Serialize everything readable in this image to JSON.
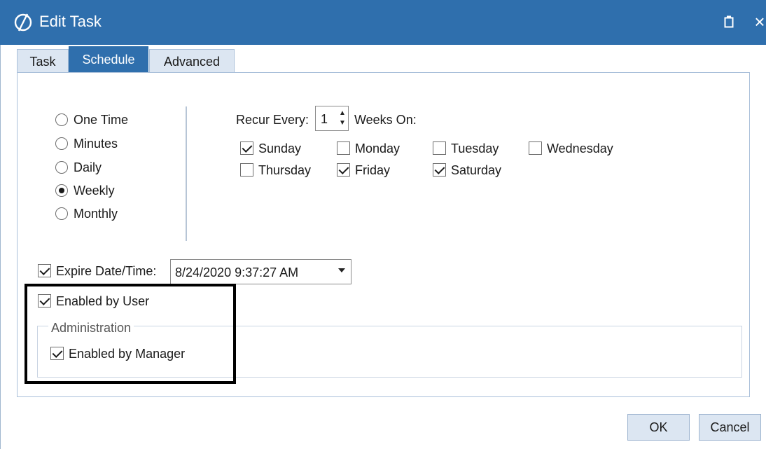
{
  "window": {
    "title": "Edit Task",
    "icons": {
      "app": "app-logo-icon",
      "restore": "restore-icon",
      "close": "close-icon"
    },
    "close_glyph": "×",
    "accent_color": "#2f6fad"
  },
  "tabs": [
    {
      "label": "Task",
      "active": false
    },
    {
      "label": "Schedule",
      "active": true
    },
    {
      "label": "Advanced",
      "active": false
    }
  ],
  "schedule": {
    "frequency_options": [
      {
        "label": "One Time",
        "checked": false
      },
      {
        "label": "Minutes",
        "checked": false
      },
      {
        "label": "Daily",
        "checked": false
      },
      {
        "label": "Weekly",
        "checked": true
      },
      {
        "label": "Monthly",
        "checked": false
      }
    ],
    "recur_label": "Recur Every:",
    "recur_value": "1",
    "weeks_on_label": "Weeks On:",
    "days": [
      {
        "label": "Sunday",
        "checked": true
      },
      {
        "label": "Monday",
        "checked": false
      },
      {
        "label": "Tuesday",
        "checked": false
      },
      {
        "label": "Wednesday",
        "checked": false
      },
      {
        "label": "Thursday",
        "checked": false
      },
      {
        "label": "Friday",
        "checked": true
      },
      {
        "label": "Saturday",
        "checked": true
      }
    ],
    "expire": {
      "label": "Expire Date/Time:",
      "checked": true,
      "value": "8/24/2020 9:37:27 AM"
    },
    "enabled_by_user": {
      "label": "Enabled by User",
      "checked": true
    },
    "administration": {
      "legend": "Administration",
      "enabled_by_manager": {
        "label": "Enabled by Manager",
        "checked": true
      }
    }
  },
  "buttons": {
    "ok": "OK",
    "cancel": "Cancel"
  }
}
